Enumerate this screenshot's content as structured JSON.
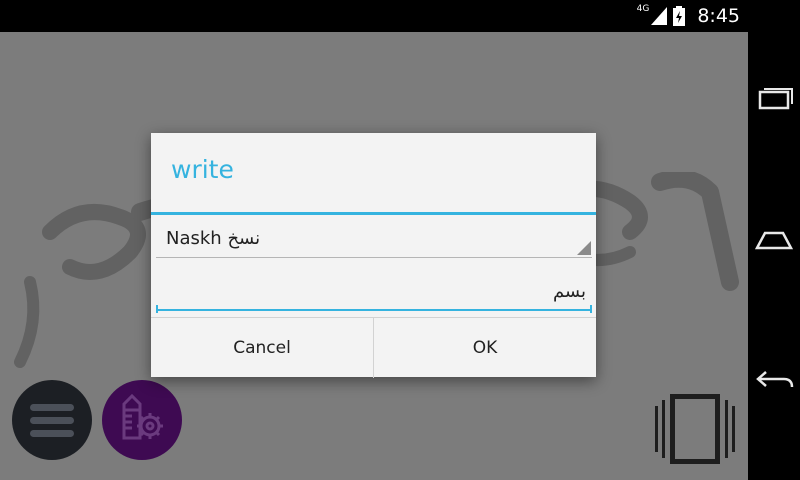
{
  "status_bar": {
    "network_label": "4G",
    "clock": "8:45"
  },
  "dialog": {
    "title": "write",
    "font_select": {
      "selected": "Naskh نسخ"
    },
    "text_input": {
      "value": "بسم"
    },
    "buttons": {
      "cancel": "Cancel",
      "ok": "OK"
    }
  },
  "colors": {
    "accent": "#35b3df",
    "canvas_bg": "#7c7c7c",
    "menu_fab": "#1c1f24",
    "tools_fab": "#3e0a52"
  },
  "icons": {
    "menu": "hamburger-icon",
    "tools": "pencil-gear-icon",
    "frame": "frame-icon",
    "nav": [
      "recent-apps-icon",
      "home-icon",
      "back-icon"
    ]
  }
}
